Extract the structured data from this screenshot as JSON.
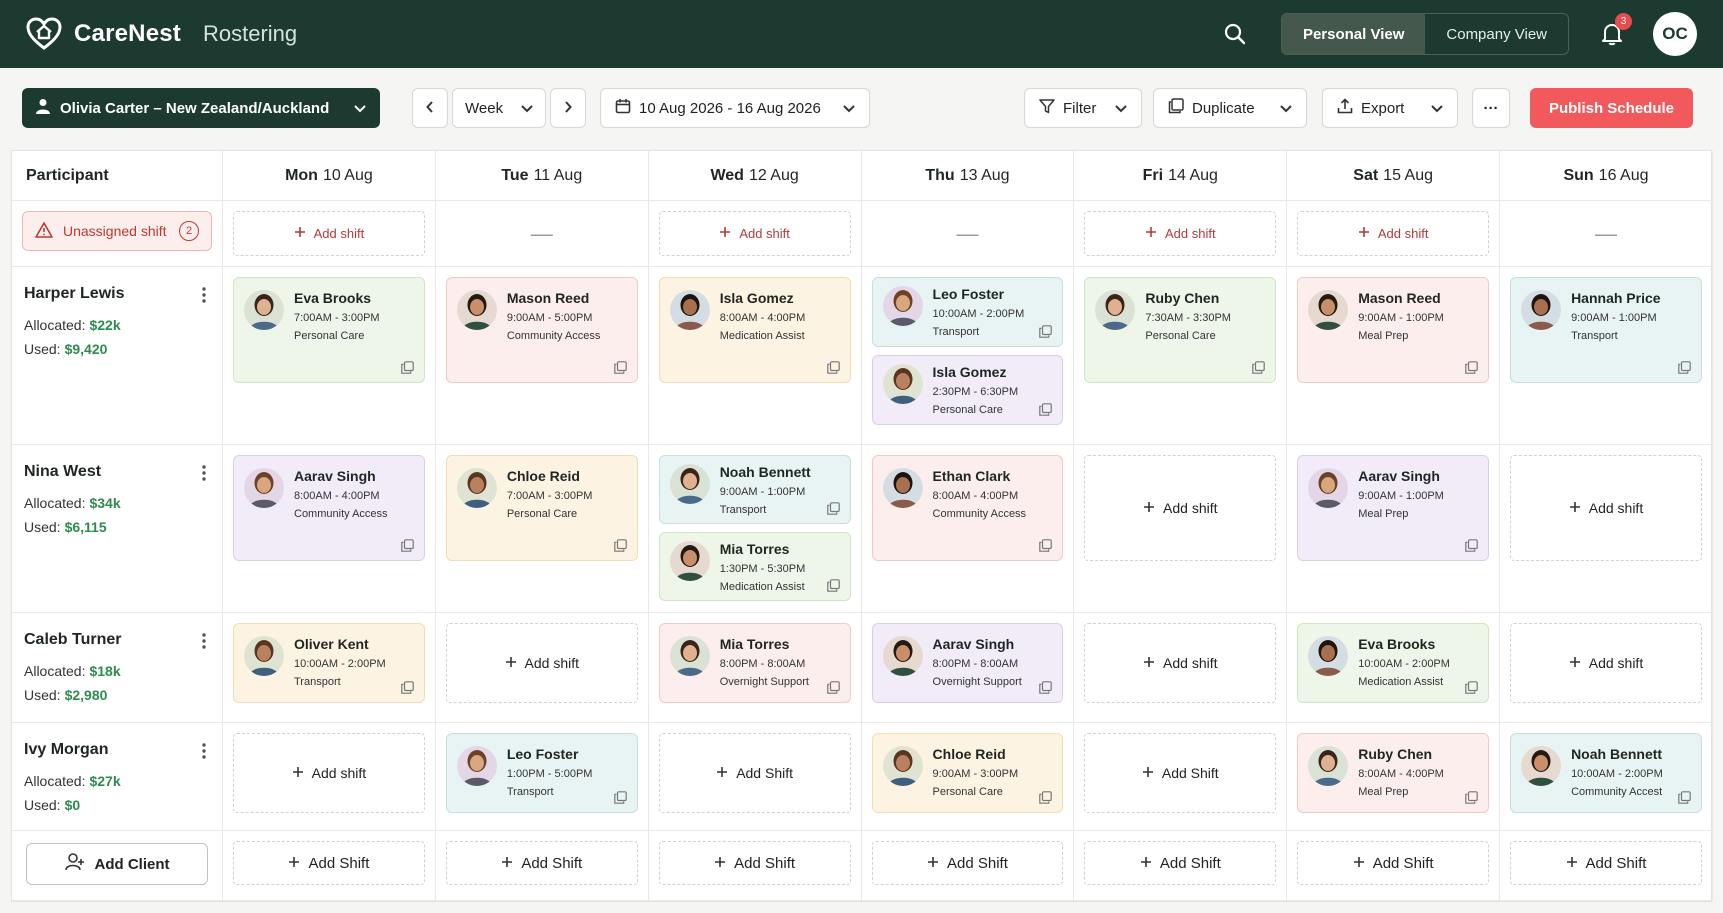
{
  "header": {
    "brand": "CareNest",
    "module": "Rostering",
    "views": [
      "Personal View",
      "Company View"
    ],
    "active_view": "Personal View",
    "notification_count": "3",
    "user_initials": "OC",
    "brand_color": "#1c3a2f",
    "accent_color": "#f2595c"
  },
  "toolbar": {
    "client": "Olivia Carter – New Zealand/Auckland",
    "range_mode": "Week",
    "date_range": "10 Aug 2026 - 16 Aug 2026",
    "filter": "Filter",
    "duplicate": "Duplicate",
    "export": "Export",
    "more": "···",
    "publish": "Publish Schedule"
  },
  "grid": {
    "participant_header": "Participant",
    "days": [
      {
        "dow": "Mon",
        "date": "10 Aug"
      },
      {
        "dow": "Tue",
        "date": "11 Aug"
      },
      {
        "dow": "Wed",
        "date": "12 Aug"
      },
      {
        "dow": "Thu",
        "date": "13 Aug"
      },
      {
        "dow": "Fri",
        "date": "14 Aug"
      },
      {
        "dow": "Sat",
        "date": "15 Aug"
      },
      {
        "dow": "Sun",
        "date": "16 Aug"
      }
    ],
    "unassigned": {
      "label": "Unassigned shift",
      "count": "2",
      "add_label": "Add shift",
      "dash": "—"
    },
    "add_shift_lower": "Add shift",
    "add_shift_title": "Add Shift",
    "add_client": "Add Client",
    "allocated_label": "Allocated:",
    "used_label": "Used:",
    "participants": [
      {
        "name": "Harper Lewis",
        "allocated": "$22k",
        "used": "$9,420"
      },
      {
        "name": "Nina West",
        "allocated": "$34k",
        "used": "$6,115"
      },
      {
        "name": "Caleb Turner",
        "allocated": "$18k",
        "used": "$2,980"
      },
      {
        "name": "Ivy Morgan",
        "allocated": "$27k",
        "used": "$0"
      }
    ],
    "shifts": {
      "r0": [
        {
          "name": "Eva Brooks",
          "time": "7:00AM - 3:00PM",
          "type": "Personal Care"
        },
        {
          "name": "Mason Reed",
          "time": "9:00AM - 5:00PM",
          "type": "Community Access"
        },
        {
          "name": "Isla Gomez",
          "time": "8:00AM - 4:00PM",
          "type": "Medication Assist"
        },
        {
          "name": "Leo Foster",
          "time": "10:00AM - 2:00PM",
          "type": "Transport"
        },
        {
          "name": "Isla Gomez",
          "time": "2:30PM - 6:30PM",
          "type": "Personal Care"
        },
        {
          "name": "Ruby Chen",
          "time": "7:30AM - 3:30PM",
          "type": "Personal Care"
        },
        {
          "name": "Mason Reed",
          "time": "9:00AM - 1:00PM",
          "type": "Meal Prep"
        },
        {
          "name": "Hannah Price",
          "time": "9:00AM - 1:00PM",
          "type": "Transport"
        }
      ],
      "r1": [
        {
          "name": "Aarav Singh",
          "time": "8:00AM - 4:00PM",
          "type": "Community Access"
        },
        {
          "name": "Chloe Reid",
          "time": "7:00AM - 3:00PM",
          "type": "Personal Care"
        },
        {
          "name": "Noah Bennett",
          "time": "9:00AM - 1:00PM",
          "type": "Transport"
        },
        {
          "name": "Mia Torres",
          "time": "1:30PM - 5:30PM",
          "type": "Medication Assist"
        },
        {
          "name": "Ethan Clark",
          "time": "8:00AM - 4:00PM",
          "type": "Community Access"
        },
        {
          "name": "Aarav Singh",
          "time": "9:00AM - 1:00PM",
          "type": "Meal Prep"
        }
      ],
      "r2": [
        {
          "name": "Oliver Kent",
          "time": "10:00AM - 2:00PM",
          "type": "Transport"
        },
        {
          "name": "Mia Torres",
          "time": "8:00PM - 8:00AM",
          "type": "Overnight Support"
        },
        {
          "name": "Aarav Singh",
          "time": "8:00PM - 8:00AM",
          "type": "Overnight Support"
        },
        {
          "name": "Eva Brooks",
          "time": "10:00AM - 2:00PM",
          "type": "Medication Assist"
        }
      ],
      "r3": [
        {
          "name": "Leo Foster",
          "time": "1:00PM - 5:00PM",
          "type": "Transport"
        },
        {
          "name": "Chloe Reid",
          "time": "9:00AM - 3:00PM",
          "type": "Personal Care"
        },
        {
          "name": "Ruby Chen",
          "time": "8:00AM - 4:00PM",
          "type": "Meal Prep"
        },
        {
          "name": "Noah Bennett",
          "time": "10:00AM - 2:00PM",
          "type": "Community Accest"
        }
      ]
    }
  }
}
